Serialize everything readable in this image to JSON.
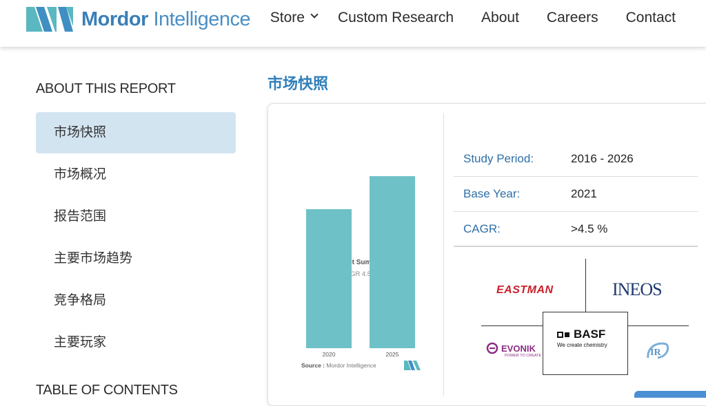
{
  "header": {
    "brand_bold": "Mordor",
    "brand_light": "Intelligence",
    "nav": [
      "Store",
      "Custom Research",
      "About",
      "Careers",
      "Contact"
    ]
  },
  "sidebar": {
    "heading": "ABOUT THIS REPORT",
    "items": [
      "市场快照",
      "市场概况",
      "报告范围",
      "主要市场趋势",
      "竞争格局",
      "主要玩家"
    ],
    "active_index": 0,
    "toc_heading": "TABLE OF CONTENTS"
  },
  "main": {
    "title": "市场快照"
  },
  "chart_data": {
    "type": "bar",
    "title": "Market Summary",
    "subtitle": "CAGR 4.5 %",
    "categories": [
      "2020",
      "2025"
    ],
    "values": [
      1.0,
      1.24
    ],
    "color": "#6ec1c6",
    "source_label": "Source :",
    "source_text": "Mordor Intelligence"
  },
  "stats": [
    {
      "label": "Study Period:",
      "value": "2016 - 2026"
    },
    {
      "label": "Base Year:",
      "value": "2021"
    },
    {
      "label": "CAGR:",
      "value": ">4.5 %"
    }
  ],
  "players": {
    "eastman": "EASTMAN",
    "ineos": "INEOS",
    "evonik": "EVONIK",
    "evonik_tag": "POWER TO CREATE",
    "basf": "BASF",
    "basf_tag": "We create chemistry"
  },
  "colors": {
    "brand_blue": "#3a7fb8",
    "accent_teal": "#6ec1c6",
    "active_bg": "#d3e4f1"
  }
}
